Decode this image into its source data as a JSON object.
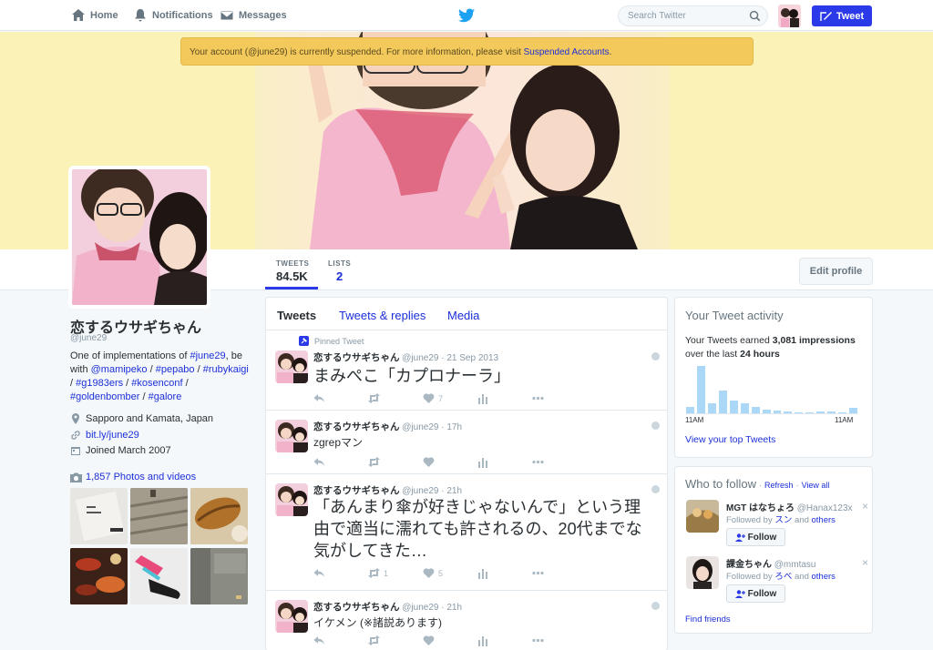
{
  "colors": {
    "accent": "#2b3ae8",
    "link": "#1b2fd8",
    "alert": "#f4c95c",
    "banner": "#faf2b7"
  },
  "topnav": {
    "home": "Home",
    "notifications": "Notifications",
    "messages": "Messages",
    "search_placeholder": "Search Twitter",
    "tweet_button": "Tweet"
  },
  "alert": {
    "text": "Your account (@june29) is currently suspended. For more information, please visit ",
    "link": "Suspended Accounts",
    "end": "."
  },
  "stats": {
    "tweets_label": "TWEETS",
    "tweets_value": "84.5K",
    "lists_label": "LISTS",
    "lists_value": "2",
    "edit_profile": "Edit profile"
  },
  "profile": {
    "name": "恋するウサギちゃん",
    "handle": "@june29",
    "bio": {
      "p1": "One of implementations of ",
      "l1": "#june29",
      "p2": ", be with ",
      "l2": "@mamipeko",
      "p3": " / ",
      "l3": "#pepabo",
      "p4": " / ",
      "l4": "#rubykaigi",
      "p5": " / ",
      "l5": "#g1983ers",
      "p6": " / ",
      "l6": "#kosenconf",
      "p7": " / ",
      "l7": "#goldenbomber",
      "p8": " / ",
      "l8": "#galore"
    },
    "location": "Sapporo and Kamata, Japan",
    "url": "bit.ly/june29",
    "joined": "Joined March 2007",
    "photos": "1,857 Photos and videos"
  },
  "tabs": {
    "tweets": "Tweets",
    "replies": "Tweets & replies",
    "media": "Media"
  },
  "tweets": [
    {
      "pinned": "Pinned Tweet",
      "name": "恋するウサギちゃん",
      "meta": "@june29 · 21 Sep 2013",
      "text": "まみぺこ「カプロナーラ」",
      "retweets": "",
      "likes": "7"
    },
    {
      "name": "恋するウサギちゃん",
      "meta": "@june29 · 17h",
      "text": "zgrepマン",
      "retweets": "",
      "likes": ""
    },
    {
      "name": "恋するウサギちゃん",
      "meta": "@june29 · 21h",
      "text": "「あんまり傘が好きじゃないんで」という理由で適当に濡れても許されるの、20代までな気がしてきた…",
      "retweets": "1",
      "likes": "5"
    },
    {
      "name": "恋するウサギちゃん",
      "meta": "@june29 · 21h",
      "text": "イケメン (※諸説あります)",
      "retweets": "",
      "likes": ""
    }
  ],
  "activity": {
    "title": "Your Tweet activity",
    "line1_a": "Your Tweets earned ",
    "line1_b": "3,081 impressions",
    "line2_a": "over the last ",
    "line2_b": "24 hours",
    "axis_start": "11AM",
    "axis_end": "11AM",
    "link": "View your top Tweets",
    "hourly_levels": [
      0.12,
      0.95,
      0.2,
      0.45,
      0.25,
      0.2,
      0.12,
      0.08,
      0.05,
      0.03,
      0.02,
      0.02,
      0.03,
      0.04,
      0.02,
      0.1
    ]
  },
  "wtf": {
    "title": "Who to follow",
    "refresh": "Refresh",
    "sep": " · ",
    "view_all": "View all",
    "find_friends": "Find friends",
    "follow_label": "Follow",
    "users": [
      {
        "name": "MGT はなちょろ",
        "handle": "@Hanax123x",
        "followed_by": "Followed by ",
        "f1": "スン",
        "and": " and ",
        "others": "others"
      },
      {
        "name": "課金ちゃん",
        "handle": "@mmtasu",
        "followed_by": "Followed by ",
        "f1": "ろべ",
        "and": " and ",
        "others": "others"
      }
    ]
  }
}
